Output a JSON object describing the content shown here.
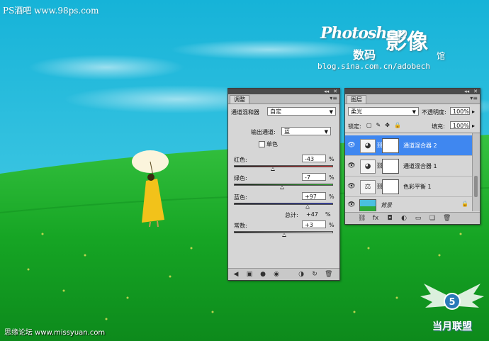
{
  "watermarks": {
    "top_left": "PS酒吧 www.98ps.com",
    "brand_en": "Photoshop",
    "brand_cn": "影像",
    "brand_sub": "数码",
    "brand_shop": "馆",
    "blog_url": "blog.sina.com.cn/adobech",
    "bottom_left": "思缘论坛 www.missyuan.com",
    "logo_text": "当月联盟"
  },
  "adjust_panel": {
    "tab_label": "调整",
    "preset_label": "通道混和器",
    "preset_value": "自定",
    "output_label": "输出通道:",
    "output_value": "蓝",
    "mono_label": "单色",
    "channels": [
      {
        "label": "红色:",
        "value": "-43",
        "unit": "%",
        "level": -43
      },
      {
        "label": "绿色:",
        "value": "-7",
        "unit": "%",
        "level": -7
      },
      {
        "label": "蓝色:",
        "value": "+97",
        "unit": "%",
        "level": 97
      }
    ],
    "total_label": "总计:",
    "total_value": "+47",
    "total_unit": "%",
    "constant_label": "常数:",
    "constant_value": "+3",
    "constant_unit": "%",
    "constant_level": 3
  },
  "layers_panel": {
    "tab_label": "图层",
    "blend_mode": "柔光",
    "opacity_label": "不透明度:",
    "opacity_value": "100%",
    "lock_label": "锁定:",
    "fill_label": "填充:",
    "fill_value": "100%",
    "layers": [
      {
        "name": "通道混合器 2",
        "selected": true
      },
      {
        "name": "通道混合器 1",
        "selected": false
      },
      {
        "name": "色彩平衡 1",
        "selected": false
      },
      {
        "name": "背景",
        "selected": false
      }
    ]
  },
  "colors": {
    "selected_layer": "#3f87f0",
    "sky": "#1fb6d8",
    "grass": "#1a9e2a"
  }
}
